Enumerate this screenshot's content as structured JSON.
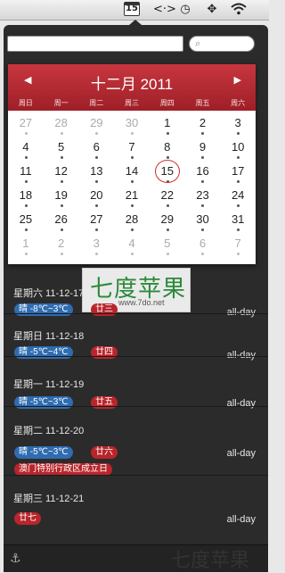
{
  "menubar": {
    "calendar_day": "15",
    "icons": [
      "calendar-icon",
      "network-icon",
      "time-machine-icon",
      "move-icon",
      "wifi-icon"
    ]
  },
  "search": {
    "text_value": "",
    "search_value": ""
  },
  "calendar": {
    "title": "十二月 2011",
    "weekdays": [
      "周日",
      "周一",
      "周二",
      "周三",
      "周四",
      "周五",
      "周六"
    ],
    "weeks": [
      [
        "27",
        "28",
        "29",
        "30",
        "1",
        "2",
        "3"
      ],
      [
        "4",
        "5",
        "6",
        "7",
        "8",
        "9",
        "10"
      ],
      [
        "11",
        "12",
        "13",
        "14",
        "15",
        "16",
        "17"
      ],
      [
        "18",
        "19",
        "20",
        "21",
        "22",
        "23",
        "24"
      ],
      [
        "25",
        "26",
        "27",
        "28",
        "29",
        "30",
        "31"
      ],
      [
        "1",
        "2",
        "3",
        "4",
        "5",
        "6",
        "7"
      ]
    ],
    "today": "15"
  },
  "watermark": {
    "text": "七度苹果",
    "url": "www.7do.net"
  },
  "events": [
    {
      "date": "星期六 11-12-17",
      "allday": "all-day",
      "weather": "晴 -8℃~3℃",
      "lunar": "廿三"
    },
    {
      "date": "星期日 11-12-18",
      "allday": "all-day",
      "weather": "晴 -5℃~4℃",
      "lunar": "廿四"
    },
    {
      "date": "星期一 11-12-19",
      "allday": "all-day",
      "weather": "晴 -5℃~3℃",
      "lunar": "廿五"
    },
    {
      "date": "星期二 11-12-20",
      "allday": "all-day",
      "weather": "晴 -5℃~3℃",
      "lunar": "廿六",
      "holiday": "澳门特别行政区成立日"
    },
    {
      "date": "星期三 11-12-21",
      "allday": "all-day",
      "lunar": "廿七"
    }
  ],
  "footer": {
    "watermark": "七度苹果"
  }
}
